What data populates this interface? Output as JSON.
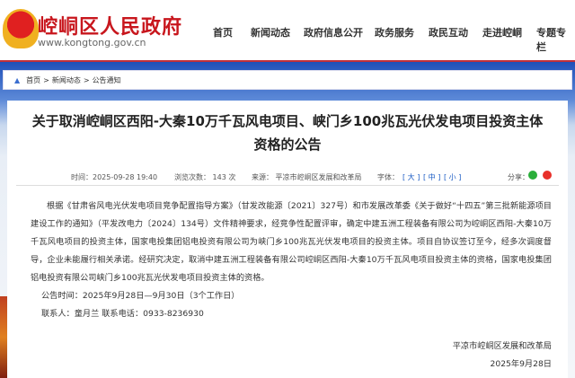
{
  "header": {
    "site_name": "崆峒区人民政府",
    "url": "www.kongtong.gov.cn",
    "nav": [
      "首页",
      "新闻动态",
      "政府信息公开",
      "政务服务",
      "政民互动",
      "走进崆峒",
      "专题专栏"
    ]
  },
  "breadcrumb": [
    "首页",
    ">",
    "新闻动态",
    ">",
    "公告通知"
  ],
  "article": {
    "title_line1": "关于取消崆峒区西阳-大秦10万千瓦风电项目、峡门乡100兆瓦光伏发电项目投资主体",
    "title_line2": "资格的公告",
    "time": "时间：2025-09-28 19:40",
    "views": "浏览次数： 143 次",
    "source": "来源： 平凉市崆峒区发展和改革局",
    "font_label": "字体：",
    "font_large": "[ 大 ]",
    "font_medium": "[ 中 ]",
    "font_small": "[ 小 ]",
    "share_label": "分享：",
    "body": "根据《甘肃省风电光伏发电项目竞争配置指导方案》（甘发改能源〔2021〕327号）和市发展改革委《关于做好“十四五”第三批新能源项目建设工作的通知》（平发改电力〔2024〕134号）文件精神要求，经竞争性配置评审，确定中建五洲工程装备有限公司为崆峒区西阳-大秦10万千瓦风电项目的投资主体，国家电投集团铝电投资有限公司为峡门乡100兆瓦光伏发电项目的投资主体。项目自协议签订至今，经多次调度督导，企业未能履行相关承诺。经研究决定，取消中建五洲工程装备有限公司崆峒区西阳-大秦10万千瓦风电项目投资主体的资格，国家电投集团铝电投资有限公司峡门乡100兆瓦光伏发电项目投资主体的资格。",
    "notice_period": "公告时间：2025年9月28日—9月30日（3个工作日）",
    "contact": "联系人：童月兰  联系电话：0933-8236930",
    "signature_org": "平凉市崆峒区发展和改革局",
    "signature_date": "2025年9月28日"
  },
  "colors": {
    "brand_red": "#c8161d",
    "link_blue": "#1a5bc4"
  }
}
